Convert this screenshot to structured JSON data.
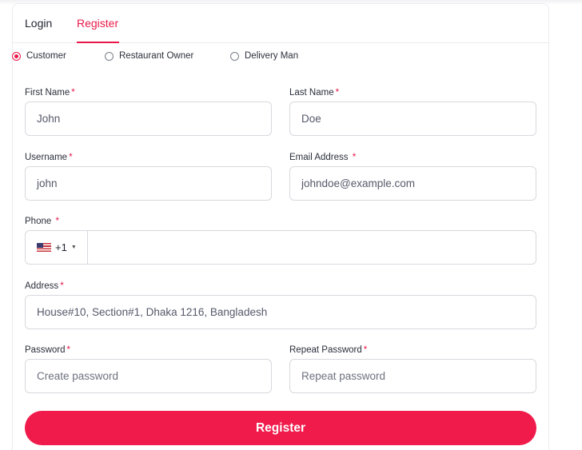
{
  "tabs": [
    {
      "label": "Login"
    },
    {
      "label": "Register"
    }
  ],
  "roles": [
    {
      "label": "Customer",
      "checked": true
    },
    {
      "label": "Restaurant Owner",
      "checked": false
    },
    {
      "label": "Delivery Man",
      "checked": false
    }
  ],
  "required_marker": "*",
  "fields": {
    "first_name": {
      "label": "First Name",
      "value": "John"
    },
    "last_name": {
      "label": "Last Name",
      "value": "Doe"
    },
    "username": {
      "label": "Username",
      "value": "john"
    },
    "email": {
      "label": "Email Address",
      "value": "johndoe@example.com"
    },
    "phone": {
      "label": "Phone",
      "dial_code": "+1",
      "value": ""
    },
    "address": {
      "label": "Address",
      "value": "House#10, Section#1, Dhaka 1216, Bangladesh"
    },
    "password": {
      "label": "Password",
      "placeholder": "Create password"
    },
    "repeat_password": {
      "label": "Repeat Password",
      "placeholder": "Repeat password"
    }
  },
  "submit_label": "Register",
  "colors": {
    "accent": "#f01a4b",
    "border": "#d8d9de"
  },
  "icons": {
    "country_flag": "us-flag-icon",
    "caret": "caret-down-icon"
  }
}
